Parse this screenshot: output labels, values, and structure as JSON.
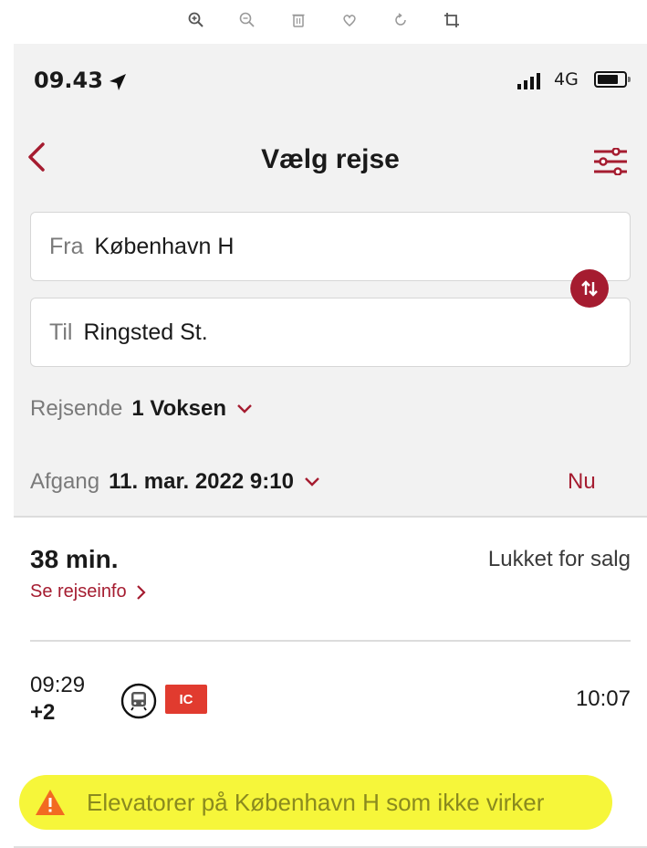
{
  "viewer": {
    "icons": [
      "zoom-in-icon",
      "zoom-out-icon",
      "trash-icon",
      "heart-icon",
      "rotate-icon",
      "crop-icon"
    ]
  },
  "status_bar": {
    "time": "09.43",
    "network": "4G"
  },
  "nav": {
    "title": "Vælg rejse"
  },
  "search": {
    "from_label": "Fra",
    "from_value": "København H",
    "to_label": "Til",
    "to_value": "Ringsted St."
  },
  "travellers": {
    "label": "Rejsende",
    "value": "1 Voksen"
  },
  "departure": {
    "label": "Afgang",
    "value": "11. mar. 2022 9:10",
    "now_label": "Nu"
  },
  "journey": {
    "duration": "38 min.",
    "sale_status": "Lukket for salg",
    "info_link": "Se rejseinfo",
    "departure_time": "09:29",
    "delay": "+2",
    "train_type": "IC",
    "arrival_time": "10:07",
    "alert_text": "Elevatorer på København H som ikke virker"
  },
  "colors": {
    "accent": "#a51c30",
    "ic_badge": "#e13b2f",
    "highlight": "#f6f63a",
    "warning": "#f26a21"
  }
}
